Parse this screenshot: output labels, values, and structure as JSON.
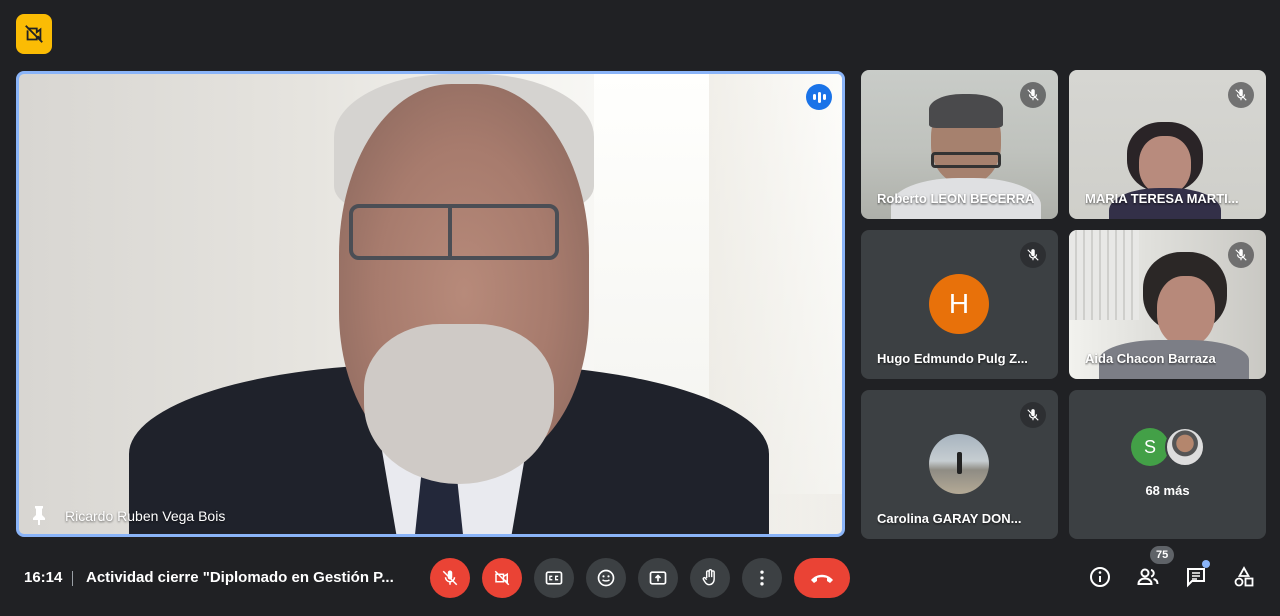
{
  "main_speaker": {
    "name": "Ricardo Ruben Vega Bois"
  },
  "participants": [
    {
      "name": "Roberto LEON BECERRA"
    },
    {
      "name": "MARIA TERESA MARTI..."
    },
    {
      "name": "Hugo Edmundo Pulg Z...",
      "initial": "H"
    },
    {
      "name": "Aida Chacon Barraza"
    },
    {
      "name": "Carolina GARAY DON..."
    }
  ],
  "more_tile": {
    "avatar_initial": "S",
    "more_label": "68 más"
  },
  "footer": {
    "time": "16:14",
    "meeting_title": "Actividad cierre \"Diplomado en Gestión P...",
    "people_count": "75"
  },
  "colors": {
    "accent": "#8ab4f8",
    "danger": "#ea4335",
    "badge": "#fbbc04",
    "background": "#202124",
    "tile": "#3c4043"
  }
}
